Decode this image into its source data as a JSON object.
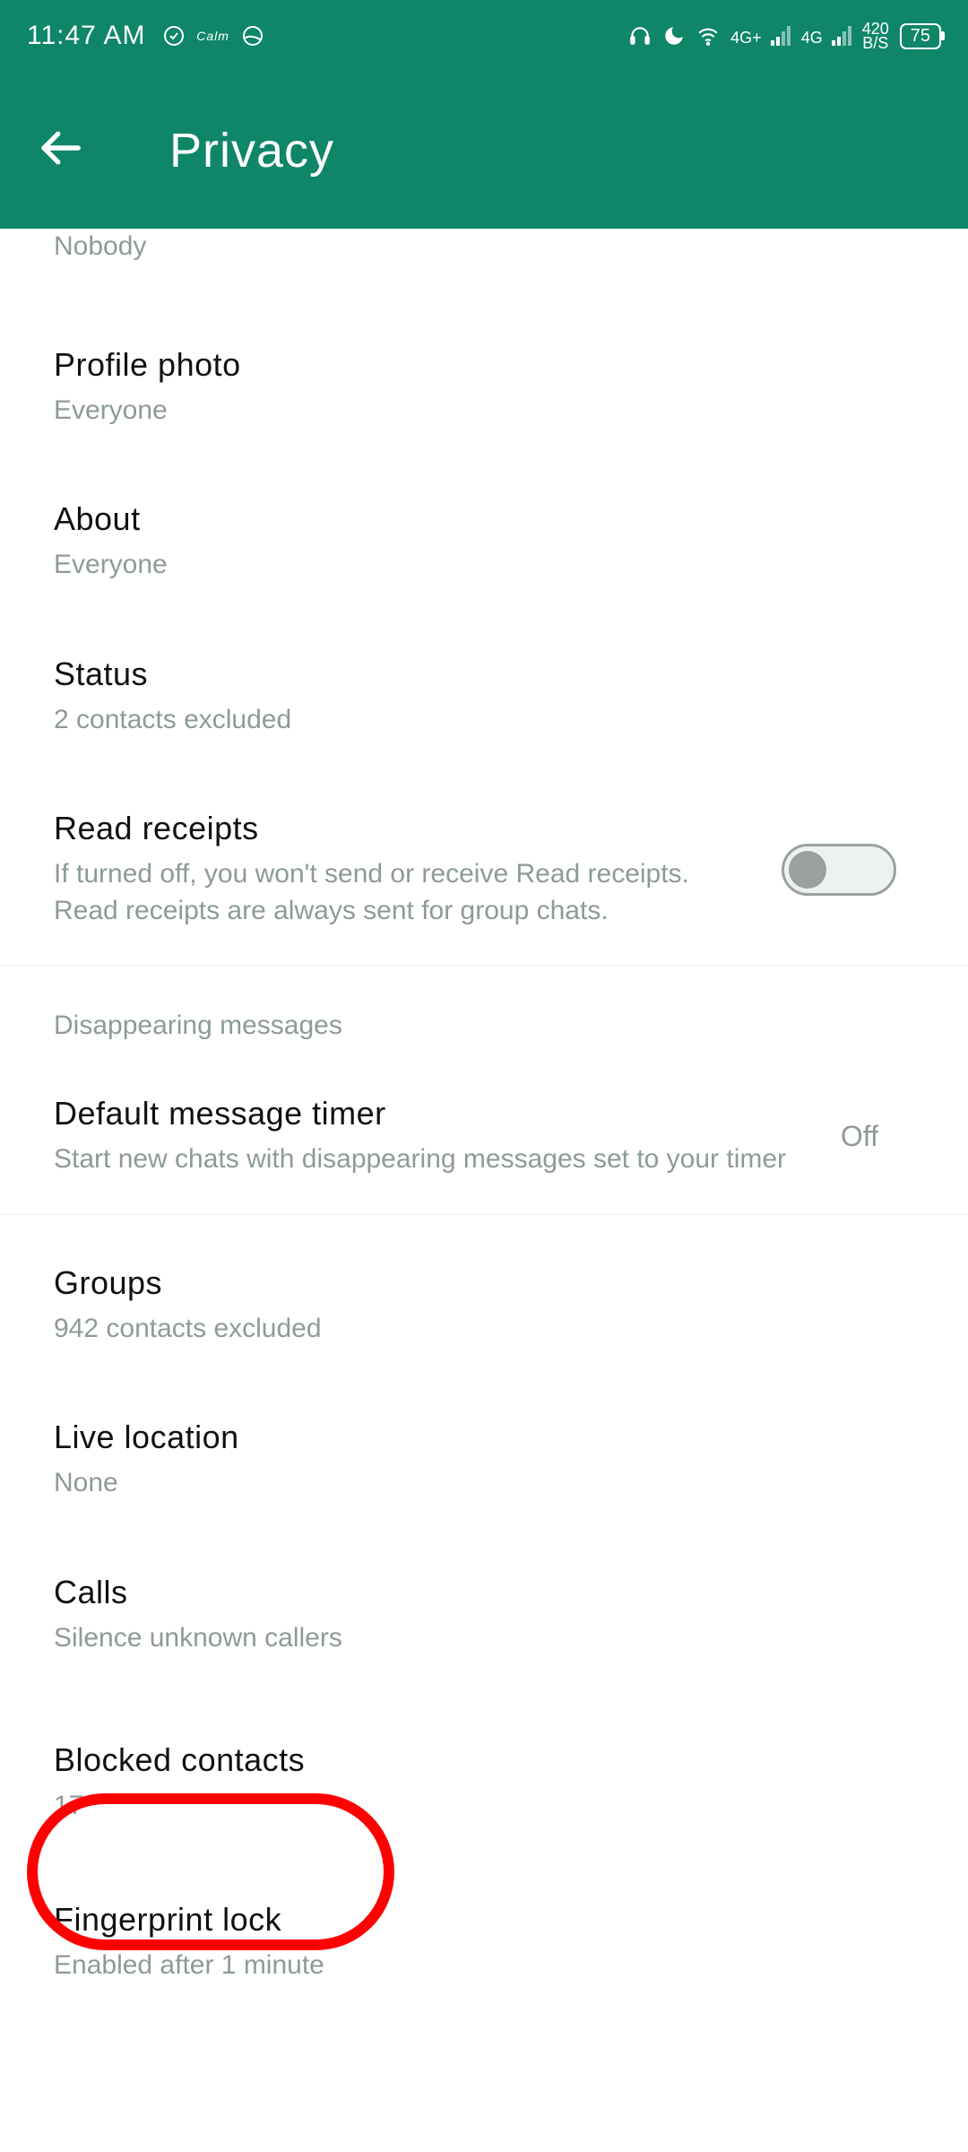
{
  "status": {
    "time": "11:47 AM",
    "sim1_label": "4G+",
    "sim2_label": "4G",
    "net_speed_top": "420",
    "net_speed_bottom": "B/S",
    "battery": "75"
  },
  "header": {
    "title": "Privacy"
  },
  "partial": {
    "sub": "Nobody"
  },
  "items": {
    "profile_photo": {
      "title": "Profile photo",
      "sub": "Everyone"
    },
    "about": {
      "title": "About",
      "sub": "Everyone"
    },
    "status_priv": {
      "title": "Status",
      "sub": "2 contacts excluded"
    },
    "read_receipts": {
      "title": "Read receipts",
      "sub": "If turned off, you won't send or receive Read receipts. Read receipts are always sent for group chats."
    },
    "disappearing_header": "Disappearing messages",
    "default_timer": {
      "title": "Default message timer",
      "sub": "Start new chats with disappearing messages set to your timer",
      "value": "Off"
    },
    "groups": {
      "title": "Groups",
      "sub": "942 contacts excluded"
    },
    "live_location": {
      "title": "Live location",
      "sub": "None"
    },
    "calls": {
      "title": "Calls",
      "sub": "Silence unknown callers"
    },
    "blocked": {
      "title": "Blocked contacts",
      "sub": "17"
    },
    "fingerprint": {
      "title": "Fingerprint lock",
      "sub": "Enabled after 1 minute"
    }
  }
}
